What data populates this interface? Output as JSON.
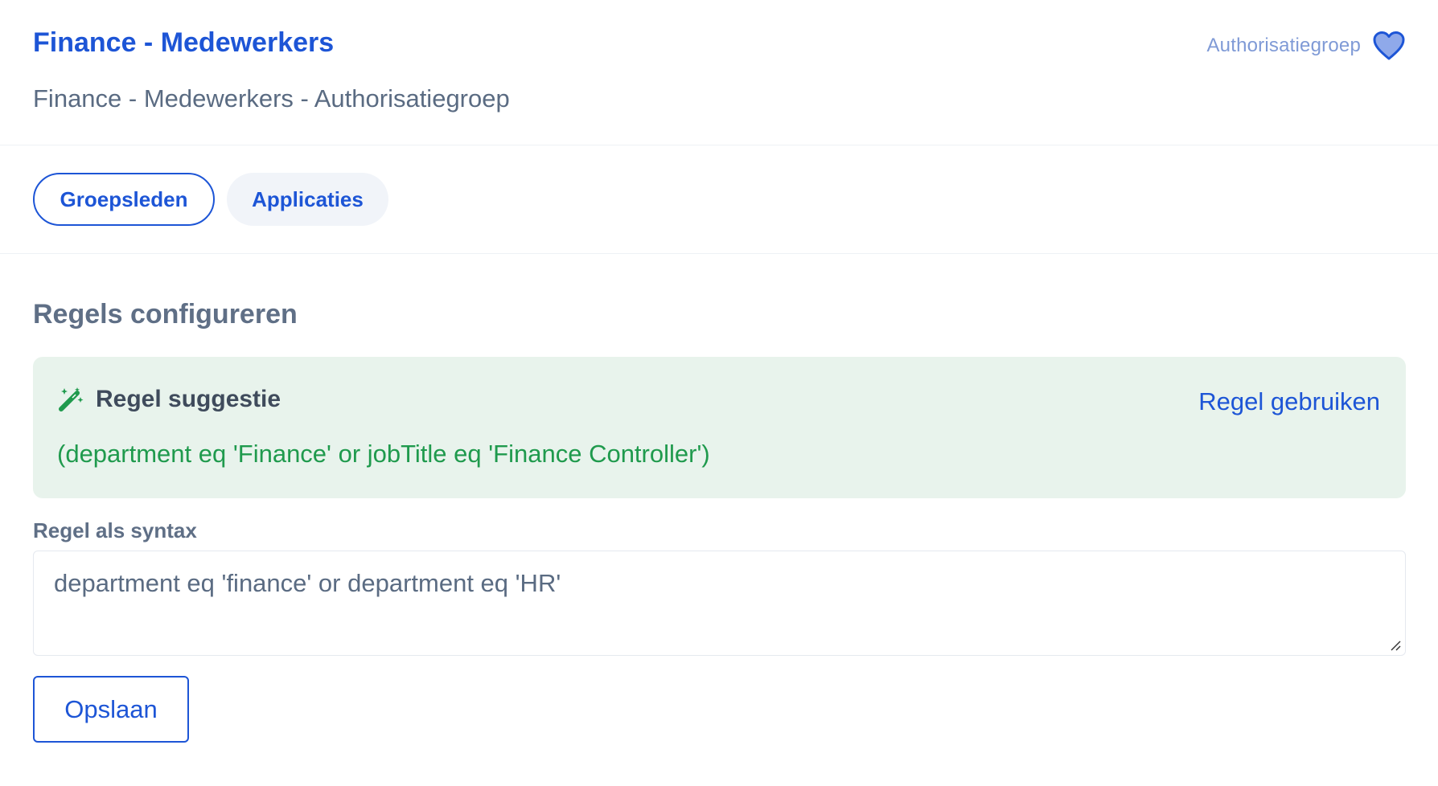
{
  "header": {
    "title": "Finance - Medewerkers",
    "subtitle": "Finance - Medewerkers - Authorisatiegroep",
    "badge_label": "Authorisatiegroep",
    "badge_icon": "heart-icon"
  },
  "tabs": [
    {
      "label": "Groepsleden",
      "active": true
    },
    {
      "label": "Applicaties",
      "active": false
    }
  ],
  "rules": {
    "section_title": "Regels configureren",
    "suggestion": {
      "icon": "magic-wand-icon",
      "title": "Regel suggestie",
      "action_label": "Regel gebruiken",
      "rule": "(department eq 'Finance' or jobTitle eq 'Finance Controller')"
    },
    "syntax_label": "Regel als syntax",
    "syntax_value": "department eq 'finance' or department eq 'HR'",
    "save_label": "Opslaan"
  },
  "colors": {
    "primary": "#1d55d6",
    "muted_text": "#5a6b82",
    "suggestion_bg": "#e8f3ec",
    "suggestion_text": "#1f9a4d",
    "badge_text": "#7f9ad6"
  }
}
